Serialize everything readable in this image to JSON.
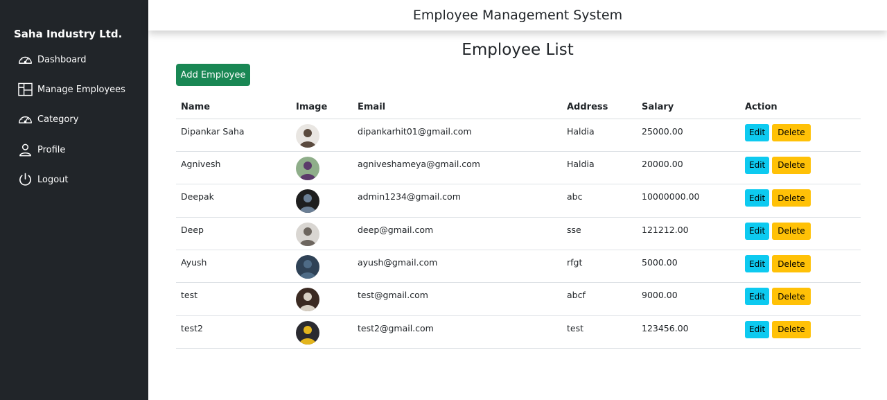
{
  "sidebar": {
    "brand": "Saha Industry Ltd.",
    "items": [
      {
        "label": "Dashboard",
        "icon": "speedometer-icon"
      },
      {
        "label": "Manage Employees",
        "icon": "columns-icon"
      },
      {
        "label": "Category",
        "icon": "speedometer-icon"
      },
      {
        "label": "Profile",
        "icon": "person-icon"
      },
      {
        "label": "Logout",
        "icon": "power-icon"
      }
    ]
  },
  "header": {
    "title": "Employee Management System"
  },
  "main": {
    "title": "Employee List",
    "add_button": "Add Employee",
    "columns": [
      "Name",
      "Image",
      "Email",
      "Address",
      "Salary",
      "Action"
    ],
    "edit_label": "Edit",
    "delete_label": "Delete",
    "rows": [
      {
        "name": "Dipankar Saha",
        "email": "dipankarhit01@gmail.com",
        "address": "Haldia",
        "salary": "25000.00",
        "avatar_colors": [
          "#e9e6e2",
          "#5a4a3e"
        ]
      },
      {
        "name": "Agnivesh",
        "email": "agniveshameya@gmail.com",
        "address": "Haldia",
        "salary": "20000.00",
        "avatar_colors": [
          "#8fae8a",
          "#5b3a6a"
        ]
      },
      {
        "name": "Deepak",
        "email": "admin1234@gmail.com",
        "address": "abc",
        "salary": "10000000.00",
        "avatar_colors": [
          "#1e1e1e",
          "#6b7f95"
        ]
      },
      {
        "name": "Deep",
        "email": "deep@gmail.com",
        "address": "sse",
        "salary": "121212.00",
        "avatar_colors": [
          "#d9d6d2",
          "#6d665f"
        ]
      },
      {
        "name": "Ayush",
        "email": "ayush@gmail.com",
        "address": "rfgt",
        "salary": "5000.00",
        "avatar_colors": [
          "#2f4256",
          "#4e6b86"
        ]
      },
      {
        "name": "test",
        "email": "test@gmail.com",
        "address": "abcf",
        "salary": "9000.00",
        "avatar_colors": [
          "#3b2a22",
          "#d8d0c4"
        ]
      },
      {
        "name": "test2",
        "email": "test2@gmail.com",
        "address": "test",
        "salary": "123456.00",
        "avatar_colors": [
          "#2a2a30",
          "#e3b51d"
        ]
      }
    ]
  },
  "colors": {
    "sidebar_bg": "#212529",
    "add_button": "#198754",
    "edit_button": "#0dcaf0",
    "delete_button": "#ffc107"
  }
}
